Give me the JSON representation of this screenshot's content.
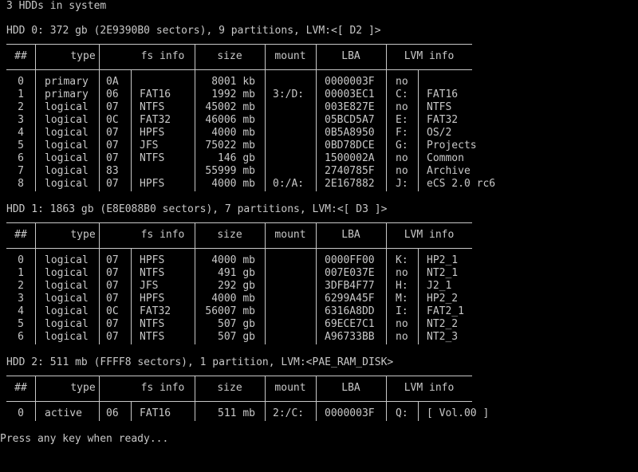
{
  "summary": "3 HDDs in system",
  "headers": [
    "##",
    "type",
    "fs info",
    "size",
    "mount",
    "LBA",
    "LVM info"
  ],
  "hdds": [
    {
      "title": "HDD 0: 372 gb (2E9390B0 sectors), 9 partitions, LVM:<[ D2 ]>",
      "rows": [
        {
          "num": "0",
          "type": "primary",
          "code": "0A",
          "fs": "",
          "size": "8001 kb",
          "mount": "",
          "lba": "0000003F",
          "drive": "no",
          "lvm": ""
        },
        {
          "num": "1",
          "type": "primary",
          "code": "06",
          "fs": "FAT16",
          "size": "1992 mb",
          "mount": "3:/D:",
          "lba": "00003EC1",
          "drive": "C:",
          "lvm": "FAT16"
        },
        {
          "num": "2",
          "type": "logical",
          "code": "07",
          "fs": "NTFS",
          "size": "45002 mb",
          "mount": "",
          "lba": "003E827E",
          "drive": "no",
          "lvm": "NTFS"
        },
        {
          "num": "3",
          "type": "logical",
          "code": "0C",
          "fs": "FAT32",
          "size": "46006 mb",
          "mount": "",
          "lba": "05BCD5A7",
          "drive": "E:",
          "lvm": "FAT32"
        },
        {
          "num": "4",
          "type": "logical",
          "code": "07",
          "fs": "HPFS",
          "size": "4000 mb",
          "mount": "",
          "lba": "0B5A8950",
          "drive": "F:",
          "lvm": "OS/2"
        },
        {
          "num": "5",
          "type": "logical",
          "code": "07",
          "fs": "JFS",
          "size": "75022 mb",
          "mount": "",
          "lba": "0BD78DCE",
          "drive": "G:",
          "lvm": "Projects"
        },
        {
          "num": "6",
          "type": "logical",
          "code": "07",
          "fs": "NTFS",
          "size": "146 gb",
          "mount": "",
          "lba": "1500002A",
          "drive": "no",
          "lvm": "Common"
        },
        {
          "num": "7",
          "type": "logical",
          "code": "83",
          "fs": "",
          "size": "55999 mb",
          "mount": "",
          "lba": "2740785F",
          "drive": "no",
          "lvm": "Archive"
        },
        {
          "num": "8",
          "type": "logical",
          "code": "07",
          "fs": "HPFS",
          "size": "4000 mb",
          "mount": "0:/A:",
          "lba": "2E167882",
          "drive": "J:",
          "lvm": "eCS 2.0 rc6"
        }
      ]
    },
    {
      "title": "HDD 1: 1863 gb (E8E088B0 sectors), 7 partitions, LVM:<[ D3 ]>",
      "rows": [
        {
          "num": "0",
          "type": "logical",
          "code": "07",
          "fs": "HPFS",
          "size": "4000 mb",
          "mount": "",
          "lba": "0000FF00",
          "drive": "K:",
          "lvm": "HP2_1"
        },
        {
          "num": "1",
          "type": "logical",
          "code": "07",
          "fs": "NTFS",
          "size": "491 gb",
          "mount": "",
          "lba": "007E037E",
          "drive": "no",
          "lvm": "NT2_1"
        },
        {
          "num": "2",
          "type": "logical",
          "code": "07",
          "fs": "JFS",
          "size": "292 gb",
          "mount": "",
          "lba": "3DFB4F77",
          "drive": "H:",
          "lvm": "J2_1"
        },
        {
          "num": "3",
          "type": "logical",
          "code": "07",
          "fs": "HPFS",
          "size": "4000 mb",
          "mount": "",
          "lba": "6299A45F",
          "drive": "M:",
          "lvm": "HP2_2"
        },
        {
          "num": "4",
          "type": "logical",
          "code": "0C",
          "fs": "FAT32",
          "size": "56007 mb",
          "mount": "",
          "lba": "6316A8DD",
          "drive": "I:",
          "lvm": "FAT2_1"
        },
        {
          "num": "5",
          "type": "logical",
          "code": "07",
          "fs": "NTFS",
          "size": "507 gb",
          "mount": "",
          "lba": "69ECE7C1",
          "drive": "no",
          "lvm": "NT2_2"
        },
        {
          "num": "6",
          "type": "logical",
          "code": "07",
          "fs": "NTFS",
          "size": "507 gb",
          "mount": "",
          "lba": "A96733BB",
          "drive": "no",
          "lvm": "NT2_3"
        }
      ]
    },
    {
      "title": "HDD 2: 511 mb (FFFF8 sectors), 1 partition, LVM:<PAE_RAM_DISK>",
      "rows": [
        {
          "num": "0",
          "type": "active",
          "code": "06",
          "fs": "FAT16",
          "size": "511 mb",
          "mount": "2:/C:",
          "lba": "0000003F",
          "drive": "Q:",
          "lvm": "[ Vol.00 ]"
        }
      ]
    }
  ],
  "prompt": "Press any key when ready...",
  "colors": {
    "background": "#000000",
    "text": "#c8c8c8"
  }
}
